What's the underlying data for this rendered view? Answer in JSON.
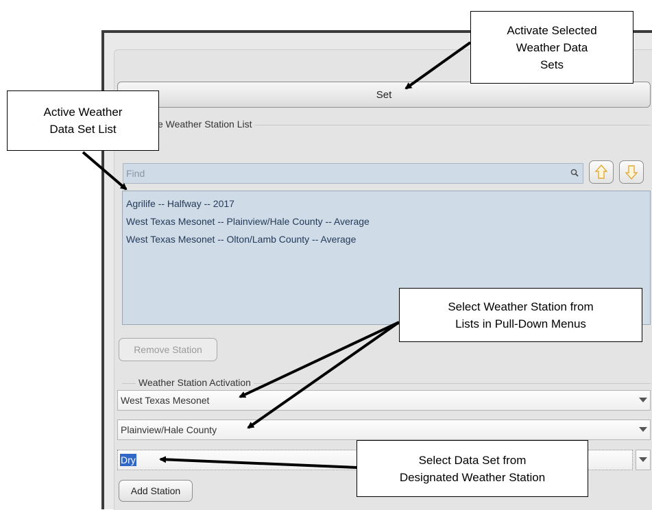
{
  "set_panel": {
    "set_button_label": "Set"
  },
  "station_list_group": {
    "legend": "e Weather Station List",
    "find_placeholder": "Find",
    "move_up_icon": "arrow-up-icon",
    "move_down_icon": "arrow-down-icon",
    "stations": [
      "Agrilife -- Halfway -- 2017",
      "West Texas Mesonet -- Plainview/Hale County -- Average",
      "West Texas Mesonet -- Olton/Lamb County -- Average"
    ],
    "remove_button_label": "Remove Station"
  },
  "activation_group": {
    "legend": "Weather Station Activation",
    "network_select": "West Texas Mesonet",
    "location_select": "Plainview/Hale County",
    "dataset_select": "Dry",
    "add_button_label": "Add Station"
  },
  "annotations": {
    "activate": "Activate Selected\nWeather Data\nSets",
    "active_list": "Active Weather\nData Set List",
    "select_station": "Select Weather Station from\nLists in Pull-Down Menus",
    "select_dataset": "Select Data Set from\nDesignated Weather Station"
  },
  "colors": {
    "list_background": "#cfdbe6",
    "selection": "#3167c7",
    "window_frame": "#3a3a3a"
  }
}
